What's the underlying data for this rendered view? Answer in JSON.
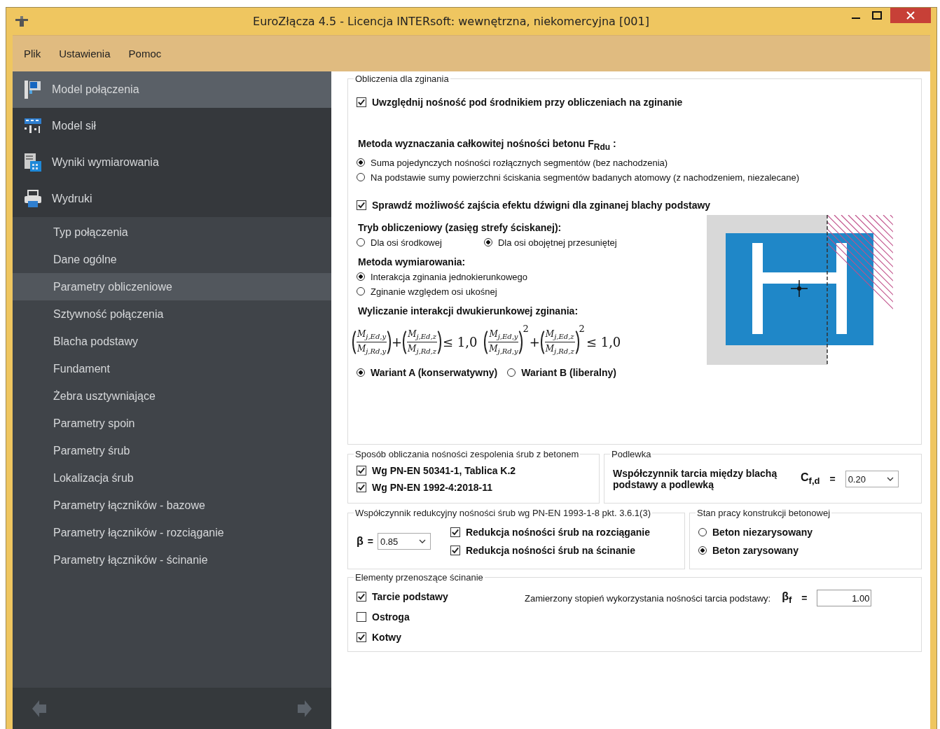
{
  "window": {
    "title": "EuroZłącza 4.5 - Licencja INTERsoft: wewnętrzna, niekomercyjna [001]"
  },
  "menu": [
    "Plik",
    "Ustawienia",
    "Pomoc"
  ],
  "sidebar": {
    "main_items": [
      {
        "label": "Model połączenia",
        "selected": true
      },
      {
        "label": "Model sił",
        "selected": false
      },
      {
        "label": "Wyniki wymiarowania",
        "selected": false
      },
      {
        "label": "Wydruki",
        "selected": false
      }
    ],
    "sub_items": [
      {
        "label": "Typ połączenia",
        "selected": false
      },
      {
        "label": "Dane ogólne",
        "selected": false
      },
      {
        "label": "Parametry obliczeniowe",
        "selected": true
      },
      {
        "label": "Sztywność połączenia",
        "selected": false
      },
      {
        "label": "Blacha podstawy",
        "selected": false
      },
      {
        "label": "Fundament",
        "selected": false
      },
      {
        "label": "Żebra usztywniające",
        "selected": false
      },
      {
        "label": "Parametry spoin",
        "selected": false
      },
      {
        "label": "Parametry śrub",
        "selected": false
      },
      {
        "label": "Lokalizacja śrub",
        "selected": false
      },
      {
        "label": "Parametry łączników - bazowe",
        "selected": false
      },
      {
        "label": "Parametry łączników - rozciąganie",
        "selected": false
      },
      {
        "label": "Parametry łączników - ścinanie",
        "selected": false
      }
    ]
  },
  "bending": {
    "title": "Obliczenia dla zginania",
    "web_check": {
      "label": "Uwzględnij nośność pod środnikiem przy obliczeniach na zginanie",
      "checked": true
    },
    "frdu_heading": "Metoda wyznaczania całkowitej nośności betonu F$_{Rdu}$ :",
    "frdu_options": [
      {
        "label": "Suma pojedynczych nośności rozłącznych segmentów (bez nachodzenia)",
        "selected": true
      },
      {
        "label": "Na podstawie sumy powierzchni ściskania segmentów badanych atomowy (z nachodzeniem, niezalecane)",
        "selected": false
      }
    ],
    "lever_check": {
      "label": "Sprawdź możliwość zajścia efektu dźwigni dla zginanej blachy podstawy",
      "checked": true
    },
    "mode_heading": "Tryb obliczeniowy (zasięg strefy ściskanej):",
    "mode_options": [
      {
        "label": "Dla osi środkowej",
        "selected": false
      },
      {
        "label": "Dla osi obojętnej przesuniętej",
        "selected": true
      }
    ],
    "method_heading": "Metoda wymiarowania:",
    "method_options": [
      {
        "label": "Interakcja zginania jednokierunkowego",
        "selected": true
      },
      {
        "label": "Zginanie względem osi ukośnej",
        "selected": false
      }
    ],
    "interaction_heading": "Wyliczanie interakcji dwukierunkowej zginania:",
    "formulas": [
      {
        "terms": [
          {
            "num": "M$_{j,Ed,y}$",
            "den": "M$_{j,Rd,y}$"
          },
          {
            "num": "M$_{j,Ed,z}$",
            "den": "M$_{j,Rd,z}$"
          }
        ],
        "operator": "+",
        "rhs": "≤ 1,0"
      },
      {
        "terms": [
          {
            "num": "M$_{j,Ed,y}$",
            "den": "M$_{j,Rd,y}$",
            "power": "2"
          },
          {
            "num": "M$_{j,Ed,z}$",
            "den": "M$_{j,Rd,z}$",
            "power": "2"
          }
        ],
        "operator": "+",
        "rhs": "≤ 1,0"
      }
    ],
    "variants": [
      {
        "label": "Wariant A (konserwatywny)",
        "selected": true
      },
      {
        "label": "Wariant B (liberalny)",
        "selected": false
      }
    ]
  },
  "anchorage": {
    "title": "Sposób obliczania nośności zespolenia śrub z betonem",
    "options": [
      {
        "label": "Wg PN-EN 50341-1, Tablica K.2",
        "checked": true
      },
      {
        "label": "Wg PN-EN 1992-4:2018-11",
        "checked": true
      }
    ]
  },
  "grout": {
    "title": "Podlewka",
    "label": "Współczynnik tarcia między blachą podstawy a podlewką",
    "symbol": "C$_{f,d}$",
    "equals": "=",
    "value": "0.20"
  },
  "reduction": {
    "title": "Współczynnik redukcyjny nośności śrub wg PN-EN 1993-1-8 pkt. 3.6.1(3)",
    "symbol": "β",
    "equals": "=",
    "value": "0.85",
    "options": [
      {
        "label": "Redukcja nośności śrub na rozciąganie",
        "checked": true
      },
      {
        "label": "Redukcja nośności śrub na ścinanie",
        "checked": true
      }
    ]
  },
  "concrete": {
    "title": "Stan pracy konstrukcji betonowej",
    "options": [
      {
        "label": "Beton niezarysowany",
        "selected": false
      },
      {
        "label": "Beton zarysowany",
        "selected": true
      }
    ]
  },
  "shear": {
    "title": "Elementy przenoszące ścinanie",
    "options": [
      {
        "label": "Tarcie podstawy",
        "checked": true
      },
      {
        "label": "Ostroga",
        "checked": false
      },
      {
        "label": "Kotwy",
        "checked": true
      }
    ],
    "friction_label": "Zamierzony stopień wykorzystania nośności tarcia podstawy:",
    "symbol": "β$_{f}$",
    "equals": "=",
    "value": "1.00"
  }
}
